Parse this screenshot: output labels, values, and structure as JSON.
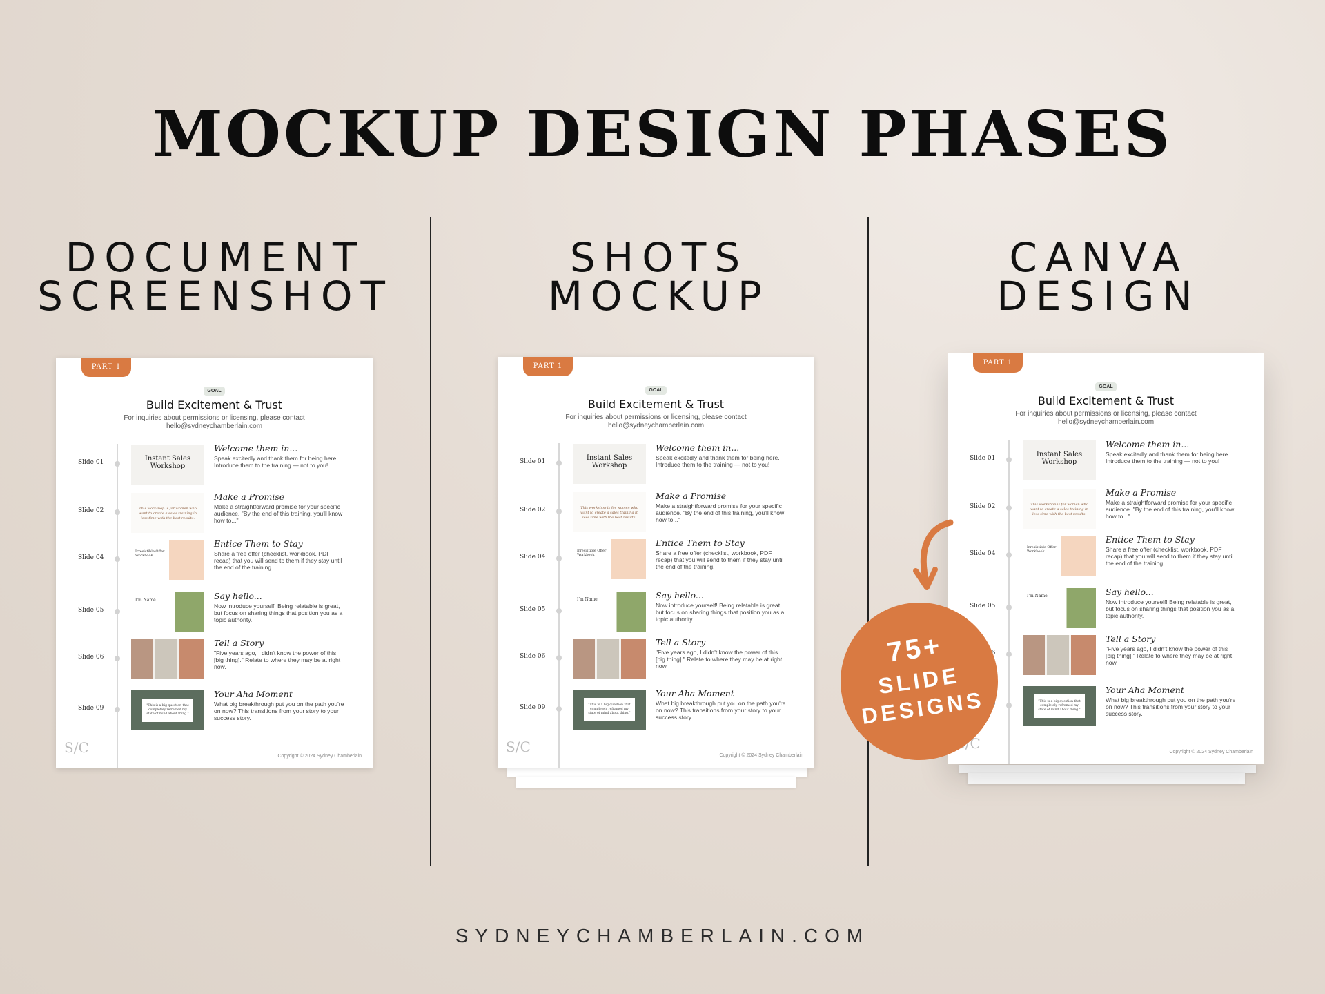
{
  "title": "MOCKUP DESIGN PHASES",
  "columns": [
    {
      "line1": "DOCUMENT",
      "line2": "SCREENSHOT"
    },
    {
      "line1": "SHOTS",
      "line2": "MOCKUP"
    },
    {
      "line1": "CANVA",
      "line2": "DESIGN"
    }
  ],
  "document": {
    "part_tab": "PART 1",
    "goal_label": "GOAL",
    "heading": "Build Excitement & Trust",
    "inquiry": "For inquiries about permissions or licensing, please contact hello@sydneychamberlain.com",
    "logo": "S/C",
    "copyright": "Copyright © 2024 Sydney Chamberlain",
    "rows": [
      {
        "slide": "Slide 01",
        "title": "Welcome them in...",
        "body": "Speak excitedly and thank them for being here. Introduce them to the training — not to you!",
        "thumb": "Instant Sales Workshop"
      },
      {
        "slide": "Slide 02",
        "title": "Make a Promise",
        "body": "Make a straightforward promise for your specific audience. \"By the end of this training, you'll know how to...\"",
        "thumb": "This workshop is for women who want to create a sales training in less time with the best results."
      },
      {
        "slide": "Slide 04",
        "title": "Entice Them to Stay",
        "body": "Share a free offer (checklist, workbook, PDF recap) that you will send to them if they stay until the end of the training.",
        "thumb": "Irresistible Offer Workbook"
      },
      {
        "slide": "Slide 05",
        "title": "Say hello...",
        "body": "Now introduce yourself! Being relatable is great, but focus on sharing things that position you as a topic authority.",
        "thumb": "I'm Name"
      },
      {
        "slide": "Slide 06",
        "title": "Tell a Story",
        "body": "\"Five years ago, I didn't know the power of this [big thing].\" Relate to where they may be at right now.",
        "thumb": ""
      },
      {
        "slide": "Slide 09",
        "title": "Your Aha Moment",
        "body": "What big breakthrough put you on the path you're on now? This transitions from your story to your success story.",
        "thumb": "\"This is a big question that completely reframed my state of mind about thing.\""
      }
    ]
  },
  "badge": {
    "line1": "75+",
    "line2": "SLIDE",
    "line3": "DESIGNS"
  },
  "footer": "SYDNEYCHAMBERLAIN.COM",
  "colors": {
    "accent": "#d97a42",
    "background": "#e6ddd5",
    "text": "#111111"
  }
}
